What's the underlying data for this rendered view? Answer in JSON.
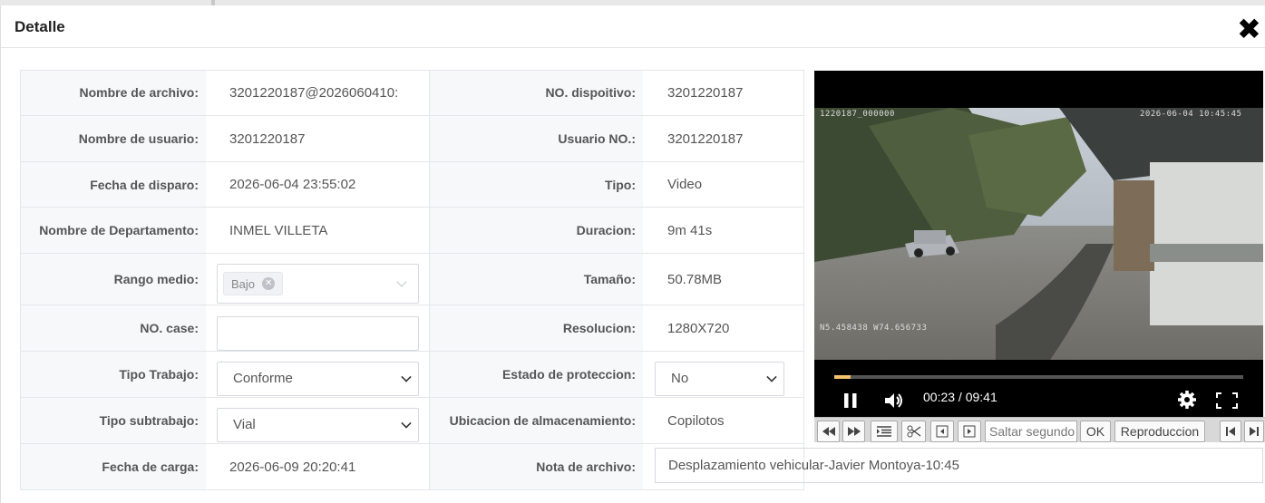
{
  "dialog": {
    "title": "Detalle",
    "close_symbol": "✖"
  },
  "fields": {
    "file_name": {
      "label": "Nombre de archivo:",
      "value": "3201220187@2026060410:"
    },
    "device_no": {
      "label": "NO. dispoitivo:",
      "value": "3201220187"
    },
    "user_name": {
      "label": "Nombre de usuario:",
      "value": "3201220187"
    },
    "user_no": {
      "label": "Usuario NO.:",
      "value": "3201220187"
    },
    "trigger_date": {
      "label": "Fecha de disparo:",
      "value": "2026-06-04 23:55:02"
    },
    "type": {
      "label": "Tipo:",
      "value": "Video"
    },
    "department": {
      "label": "Nombre de Departamento:",
      "value": "INMEL VILLETA"
    },
    "duration": {
      "label": "Duracion:",
      "value": "9m 41s"
    },
    "range": {
      "label": "Rango medio:",
      "tag": "Bajo"
    },
    "size": {
      "label": "Tamaño:",
      "value": "50.78MB"
    },
    "case_no": {
      "label": "NO. case:",
      "value": ""
    },
    "resolution": {
      "label": "Resolucion:",
      "value": "1280X720"
    },
    "work_type": {
      "label": "Tipo Trabajo:",
      "value": "Conforme"
    },
    "protection": {
      "label": "Estado de proteccion:",
      "value": "No"
    },
    "work_subtype": {
      "label": "Tipo subtrabajo:",
      "value": "Vial"
    },
    "storage": {
      "label": "Ubicacion de almacenamiento:",
      "value": "Copilotos"
    },
    "upload_date": {
      "label": "Fecha de carga:",
      "value": "2026-06-09 20:20:41"
    },
    "file_note": {
      "label": "Nota de archivo:",
      "value": "Desplazamiento vehicular-Javier Montoya-10:45"
    }
  },
  "video": {
    "osd_device": "1220187_000000",
    "osd_datetime": "2026-06-04  10:45:45",
    "osd_coords": "N5.458438  W74.656733",
    "time": "00:23 / 09:41",
    "progress_fraction": 0.04
  },
  "toolbar": {
    "seek_placeholder": "Saltar segundo",
    "ok_label": "OK",
    "play_label": "Reproduccion"
  },
  "icons": [
    "close-icon",
    "chevron-down-icon",
    "pause-icon",
    "volume-icon",
    "gear-icon",
    "fullscreen-icon",
    "rewind-icon",
    "fast-forward-icon",
    "list-icon",
    "scissors-icon",
    "prev-frame-icon",
    "next-frame-icon",
    "skip-start-icon",
    "skip-end-icon"
  ]
}
